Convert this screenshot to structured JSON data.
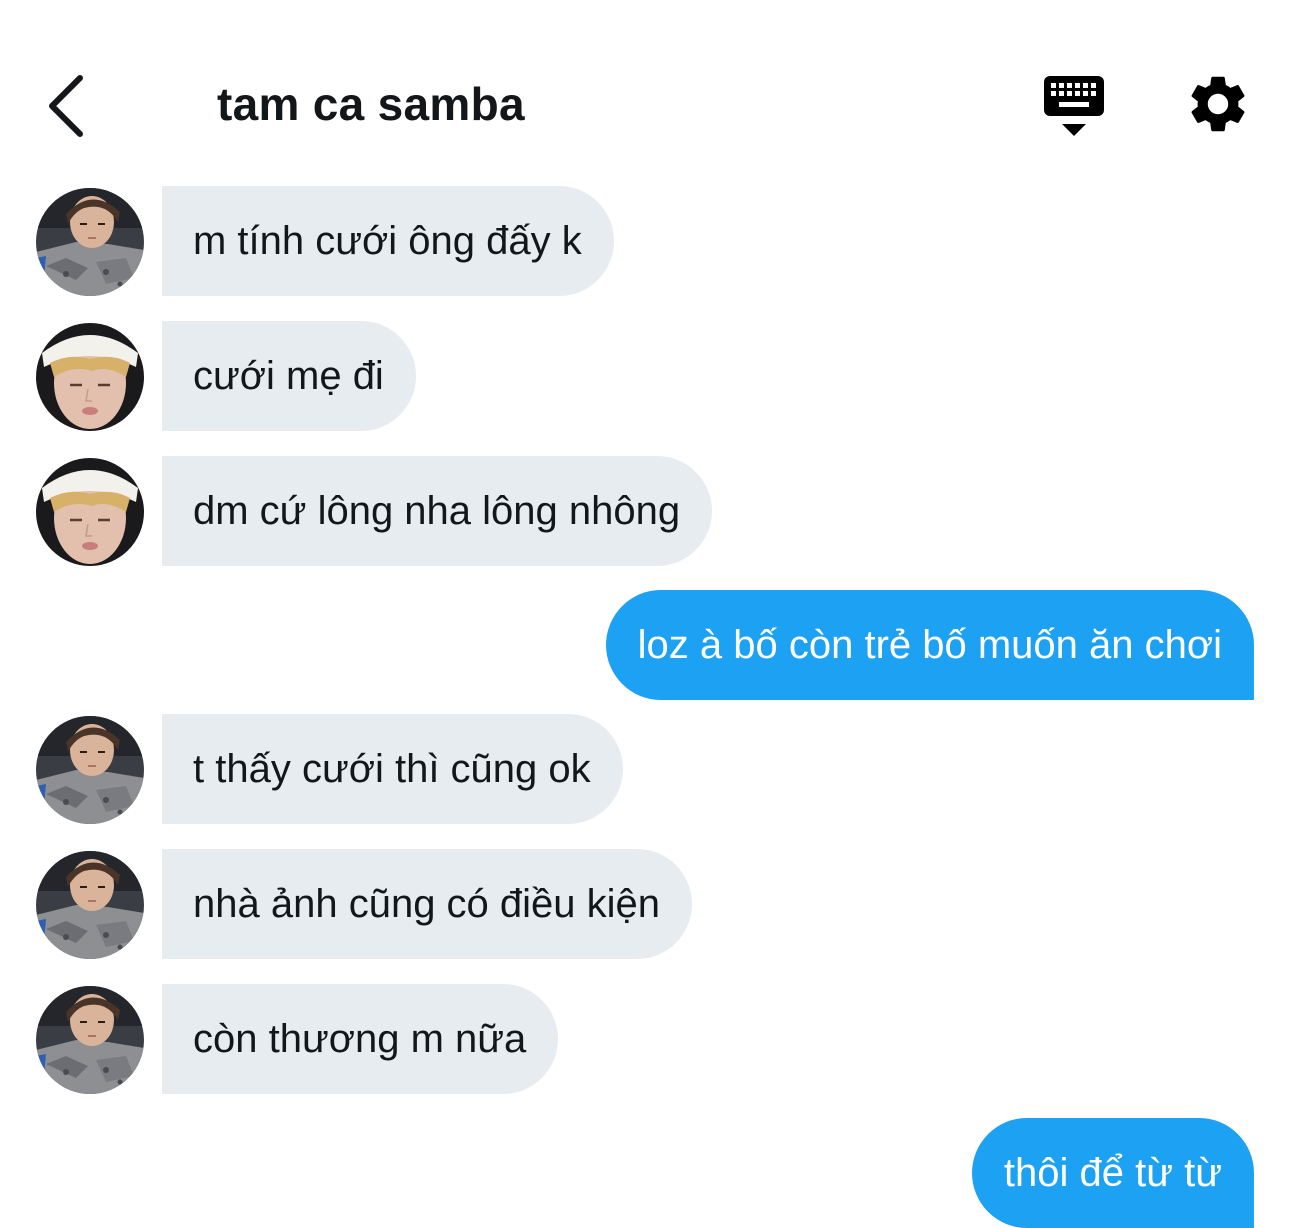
{
  "header": {
    "title": "tam ca samba",
    "back_icon": "chevron-left-icon",
    "keyboard_icon": "keyboard-icon",
    "settings_icon": "gear-icon"
  },
  "colors": {
    "incoming_bubble": "#e6ecf0",
    "outgoing_bubble": "#1da1f2",
    "text": "#14171a"
  },
  "messages": [
    {
      "direction": "in",
      "avatar": "avatar-dark-hair",
      "text": "m tính cưới ông đấy k"
    },
    {
      "direction": "in",
      "avatar": "avatar-blonde-hat",
      "text": "cưới mẹ đi"
    },
    {
      "direction": "in",
      "avatar": "avatar-blonde-hat",
      "text": "dm cứ lông nha lông nhông"
    },
    {
      "direction": "out",
      "text": "loz à bố còn trẻ bố muốn ăn chơi"
    },
    {
      "direction": "in",
      "avatar": "avatar-dark-hair",
      "text": "t thấy cưới thì cũng ok"
    },
    {
      "direction": "in",
      "avatar": "avatar-dark-hair",
      "text": "nhà ảnh cũng có điều kiện"
    },
    {
      "direction": "in",
      "avatar": "avatar-dark-hair",
      "text": "còn thương m nữa"
    },
    {
      "direction": "out",
      "text": "thôi để từ từ"
    }
  ]
}
